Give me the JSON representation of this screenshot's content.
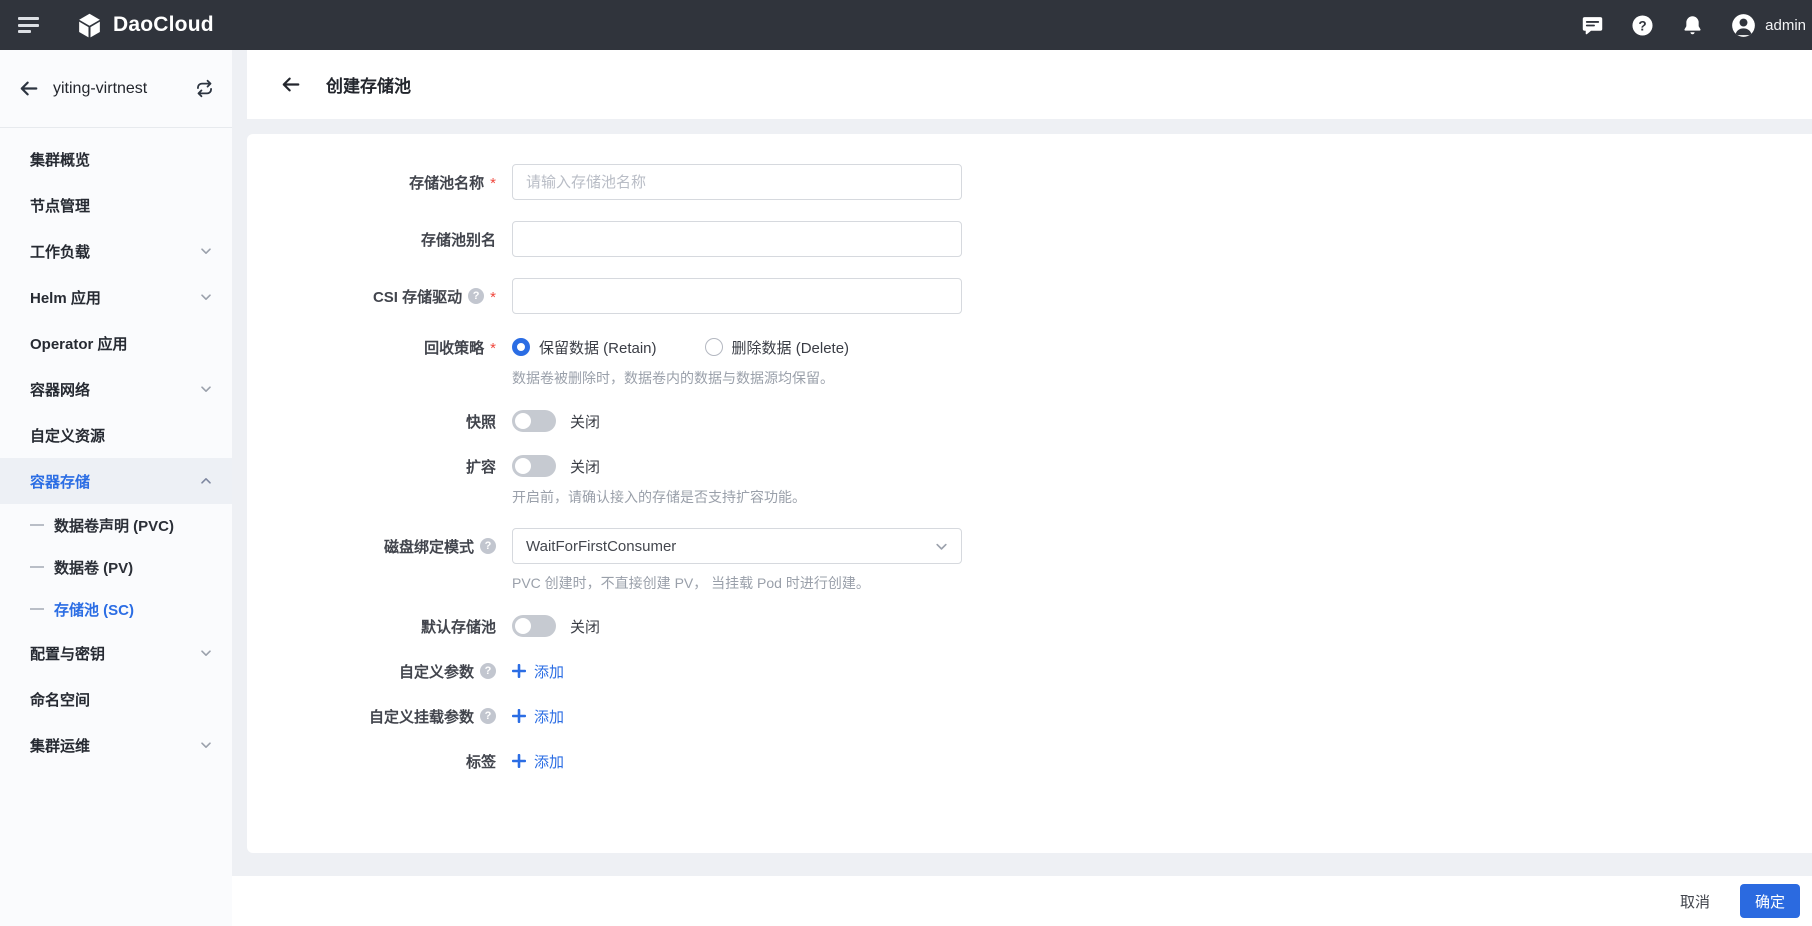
{
  "topbar": {
    "brand": "DaoCloud",
    "user": "admin",
    "icons": [
      "hamburger-icon",
      "brand-cube-icon",
      "message-icon",
      "help-icon",
      "bell-icon",
      "user-avatar"
    ]
  },
  "sidebar": {
    "cluster_name": "yiting-virtnest",
    "items": [
      {
        "label": "集群概览"
      },
      {
        "label": "节点管理"
      },
      {
        "label": "工作负载",
        "chevron": "down"
      },
      {
        "label": "Helm 应用",
        "chevron": "down"
      },
      {
        "label": "Operator 应用"
      },
      {
        "label": "容器网络",
        "chevron": "down"
      },
      {
        "label": "自定义资源"
      },
      {
        "label": "容器存储",
        "chevron": "up",
        "active": true
      },
      {
        "label": "数据卷声明 (PVC)",
        "sub": true
      },
      {
        "label": "数据卷 (PV)",
        "sub": true
      },
      {
        "label": "存储池 (SC)",
        "sub": true,
        "selected": true
      },
      {
        "label": "配置与密钥",
        "chevron": "down"
      },
      {
        "label": "命名空间"
      },
      {
        "label": "集群运维",
        "chevron": "down"
      }
    ]
  },
  "page": {
    "title": "创建存储池"
  },
  "form": {
    "required_marker": "*",
    "help_glyph": "?",
    "name": {
      "label": "存储池名称",
      "placeholder": "请输入存储池名称",
      "value": "",
      "required": true
    },
    "alias": {
      "label": "存储池别名",
      "value": ""
    },
    "csi": {
      "label": "CSI 存储驱动",
      "value": "",
      "required": true,
      "help": true
    },
    "reclaim": {
      "label": "回收策略",
      "required": true,
      "options": [
        "保留数据 (Retain)",
        "删除数据 (Delete)"
      ],
      "selected": "保留数据 (Retain)",
      "hint": "数据卷被删除时，数据卷内的数据与数据源均保留。"
    },
    "snapshot": {
      "label": "快照",
      "state": "关闭",
      "enabled": false
    },
    "expansion": {
      "label": "扩容",
      "state": "关闭",
      "enabled": false,
      "hint": "开启前，请确认接入的存储是否支持扩容功能。"
    },
    "binding_mode": {
      "label": "磁盘绑定模式",
      "help": true,
      "value": "WaitForFirstConsumer",
      "hint": "PVC 创建时，不直接创建 PV， 当挂载 Pod 时进行创建。"
    },
    "default_pool": {
      "label": "默认存储池",
      "state": "关闭",
      "enabled": false
    },
    "custom_params": {
      "label": "自定义参数",
      "help": true,
      "add_label": "添加"
    },
    "custom_mount_params": {
      "label": "自定义挂载参数",
      "help": true,
      "add_label": "添加"
    },
    "labels": {
      "label": "标签",
      "add_label": "添加"
    }
  },
  "footer": {
    "cancel": "取消",
    "confirm": "确定"
  },
  "colors": {
    "accent": "#2b6de4",
    "topbar_bg": "#30343c",
    "confirm_bg": "#2b6ae0",
    "required": "#f0483e",
    "sidebar_active_bg": "#edf0f5",
    "hint_text": "#9aa0aa"
  }
}
